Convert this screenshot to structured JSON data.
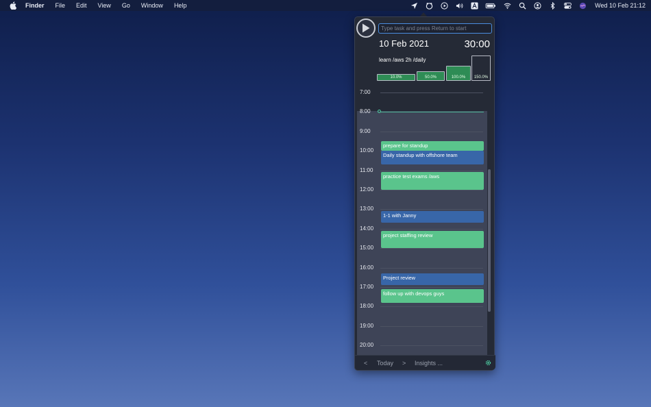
{
  "menubar": {
    "apple_icon": "apple-icon",
    "app_name": "Finder",
    "menus": [
      "File",
      "Edit",
      "View",
      "Go",
      "Window",
      "Help"
    ],
    "status_icons": [
      "location-arrow-icon",
      "timer-app-icon",
      "play-circle-icon",
      "volume-icon",
      "text-input-icon",
      "battery-icon",
      "wifi-icon",
      "search-icon",
      "user-icon",
      "bluetooth-icon",
      "control-center-icon",
      "siri-icon"
    ],
    "clock": "Wed 10 Feb  21:12"
  },
  "panel": {
    "input_placeholder": "Type task and press Return to start",
    "date": "10 Feb 2021",
    "timer": "30:00",
    "goal": "learn /aws 2h /daily",
    "progress": [
      {
        "label": "10.0%",
        "value": 10.0
      },
      {
        "label": "50.0%",
        "value": 50.0
      },
      {
        "label": "100.0%",
        "value": 100.0
      },
      {
        "label": "150.0%",
        "value": 150.0
      }
    ],
    "hours": [
      "7:00",
      "8:00",
      "9:00",
      "10:00",
      "11:00",
      "12:00",
      "13:00",
      "14:00",
      "15:00",
      "16:00",
      "17:00",
      "18:00",
      "19:00",
      "20:00"
    ],
    "events": [
      {
        "title": "prepare for standup",
        "kind": "green",
        "start": 10.5,
        "end": 11.0
      },
      {
        "title": "Daily standup with offshore team",
        "kind": "blue",
        "start": 11.0,
        "end": 11.7
      },
      {
        "title": "practice test exams /aws",
        "kind": "green",
        "start": 12.1,
        "end": 13.0
      },
      {
        "title": "1-1 with Janny",
        "kind": "blue",
        "start": 14.1,
        "end": 14.7
      },
      {
        "title": "project staffing review",
        "kind": "green",
        "start": 15.1,
        "end": 16.0
      },
      {
        "title": "Project review",
        "kind": "blue",
        "start": 17.3,
        "end": 17.9
      },
      {
        "title": "follow up with devops guys",
        "kind": "green",
        "start": 18.1,
        "end": 18.8
      }
    ],
    "footer": {
      "prev": "<",
      "today": "Today",
      "next": ">",
      "insights": "Insights ..."
    },
    "colors": {
      "accent": "#4a8de0",
      "event_green": "#5ac48c",
      "event_blue": "#3866a8",
      "now_indicator": "#4fd1a5"
    }
  }
}
